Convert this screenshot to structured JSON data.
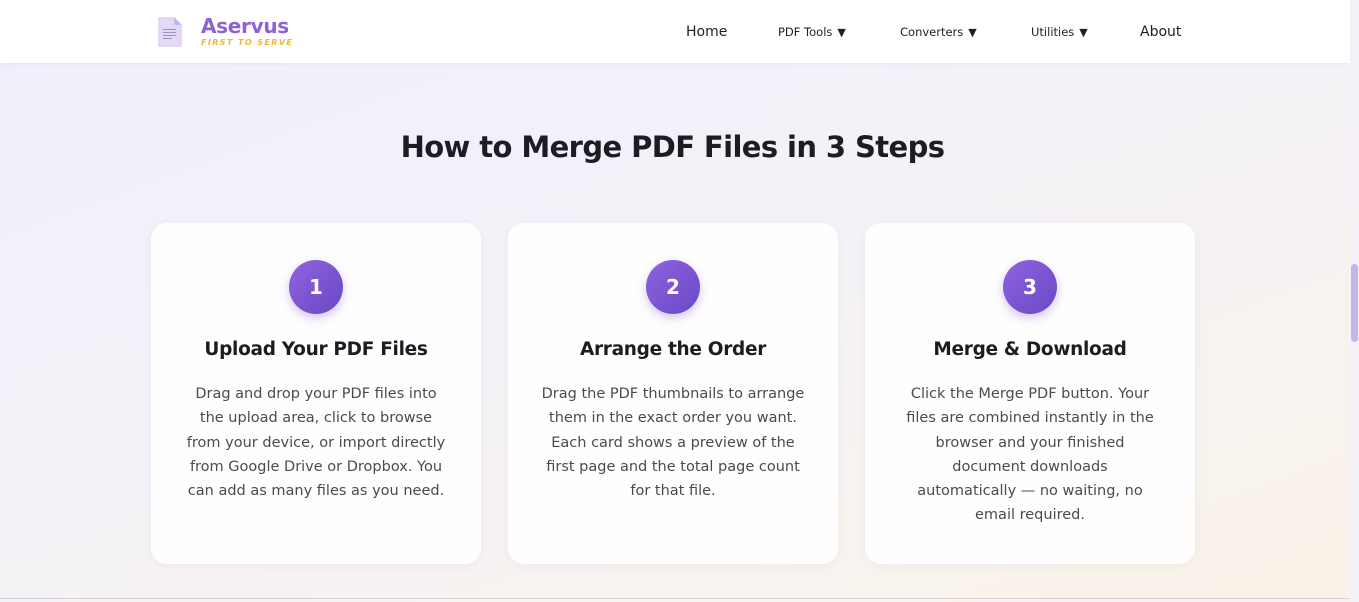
{
  "brand": {
    "name": "Aservus",
    "tagline": "FIRST TO SERVE",
    "logo_icon": "document-icon"
  },
  "nav": {
    "home": "Home",
    "pdf_tools": "PDF Tools",
    "converters": "Converters",
    "utilities": "Utilities",
    "about": "About",
    "caret": "▼"
  },
  "section": {
    "title": "How to Merge PDF Files in 3 Steps"
  },
  "steps": [
    {
      "number": "1",
      "title": "Upload Your PDF Files",
      "lines": [
        "Drag and drop your PDF files into",
        "the upload area, click to browse",
        "from your device, or import directly",
        "from Google Drive or Dropbox. You",
        "can add as many files as you need."
      ]
    },
    {
      "number": "2",
      "title": "Arrange the Order",
      "lines": [
        "Drag the PDF thumbnails to arrange",
        "them in the exact order you want.",
        "Each card shows a preview of the",
        "first page and the total page count",
        "for that file."
      ]
    },
    {
      "number": "3",
      "title": "Merge & Download",
      "lines": [
        "Click the Merge PDF button. Your",
        "files are combined instantly in the",
        "browser and your finished",
        "document downloads",
        "automatically — no waiting, no",
        "email required."
      ]
    }
  ],
  "colors": {
    "brand": "#8c62d4",
    "tagline": "#f0b43a",
    "badge": "#7b55d4"
  }
}
